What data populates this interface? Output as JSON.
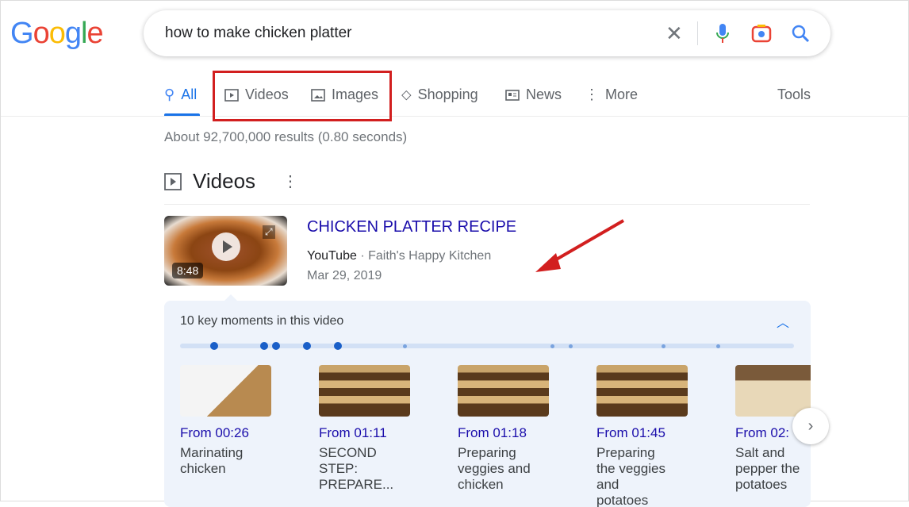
{
  "logo": "Google",
  "search": {
    "query": "how to make chicken platter"
  },
  "tabs": [
    {
      "label": "All"
    },
    {
      "label": "Videos"
    },
    {
      "label": "Images"
    },
    {
      "label": "Shopping"
    },
    {
      "label": "News"
    },
    {
      "label": "More"
    }
  ],
  "tools_label": "Tools",
  "stats": "About 92,700,000 results (0.80 seconds)",
  "videos_section": {
    "title": "Videos"
  },
  "video": {
    "title": "CHICKEN PLATTER RECIPE",
    "source": "YouTube",
    "separator": " · ",
    "channel": "Faith's Happy Kitchen",
    "date": "Mar 29, 2019",
    "duration": "8:48"
  },
  "key_moments": {
    "title": "10 key moments in this video",
    "moments": [
      {
        "from": "From 00:26",
        "desc": "Marinating chicken"
      },
      {
        "from": "From 01:11",
        "desc": "SECOND STEP: PREPARE..."
      },
      {
        "from": "From 01:18",
        "desc": "Preparing veggies and chicken"
      },
      {
        "from": "From 01:45",
        "desc": "Preparing the veggies and potatoes"
      },
      {
        "from": "From 02:",
        "desc": "Salt and pepper the potatoes"
      }
    ]
  },
  "colors": {
    "link": "#1a0dab",
    "accent": "#1a73e8",
    "annotation": "#d21f1f"
  }
}
